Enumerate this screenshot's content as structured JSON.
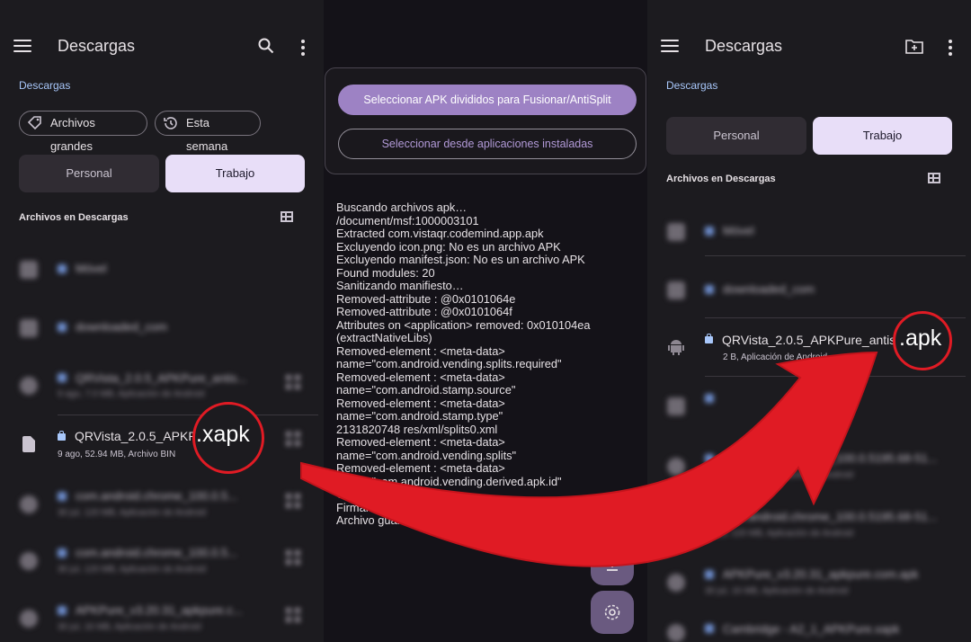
{
  "left": {
    "title": "Descargas",
    "breadcrumb": "Descargas",
    "chips": [
      "Archivos grandes",
      "Esta semana"
    ],
    "tabs": [
      "Personal",
      "Trabajo"
    ],
    "section": "Archivos en Descargas",
    "rows": [
      {
        "name": "Móvel"
      },
      {
        "name": "downloaded_com"
      },
      {
        "name": "QRVista_2.0.5_APKPure_antis...",
        "sub": "9 ago, 7.0 MB, Aplicación de Android"
      },
      {
        "name": "QRVista_2.0.5_APKP",
        "sub": "9 ago, 52.94 MB, Archivo BIN",
        "ext": ".xapk",
        "highlight": true
      },
      {
        "name": "com.android.chrome_100.0.5...",
        "sub": "30 jul, 120 MB, Aplicación de Android"
      },
      {
        "name": "com.android.chrome_100.0.5...",
        "sub": "30 jul, 120 MB, Aplicación de Android"
      },
      {
        "name": "APKPure_v3.20.31_apkpure.c...",
        "sub": "30 jul, 16 MB, Aplicación de Android"
      }
    ]
  },
  "mid": {
    "primary_button": "Seleccionar APK divididos para Fusionar/AntiSplit",
    "secondary_button": "Seleccionar desde aplicaciones instaladas",
    "log": [
      "Buscando archivos apk…",
      "/document/msf:1000003101",
      "Extracted com.vistaqr.codemind.app.apk",
      "Excluyendo icon.png: No es un archivo APK",
      "Excluyendo manifest.json: No es un archivo APK",
      "Found modules: 20",
      "Sanitizando manifiesto…",
      "Removed-attribute : @0x0101064e",
      "Removed-attribute : @0x0101064f",
      "Attributes on <application> removed: 0x010104ea",
      "(extractNativeLibs)",
      "Removed-element : <meta-data>",
      "name=\"com.android.vending.splits.required\"",
      "Removed-element : <meta-data>",
      "name=\"com.android.stamp.source\"",
      "Removed-element : <meta-data>",
      "name=\"com.android.stamp.type\"",
      "2131820748 res/xml/splits0.xml",
      "Removed-element : <meta-data>",
      "name=\"com.android.vending.splits\"",
      "Removed-element : <meta-data>",
      "name=\"com.android.vending.derived.apk.id\"",
      "Gu",
      "Firmando",
      "Archivo guardado exito"
    ]
  },
  "right": {
    "title": "Descargas",
    "breadcrumb": "Descargas",
    "tabs": [
      "Personal",
      "Trabajo"
    ],
    "section": "Archivos en Descargas",
    "rows": [
      {
        "name": "Móvel"
      },
      {
        "name": "downloaded_com"
      },
      {
        "name": "QRVista_2.0.5_APKPure_antis",
        "sub": "2 B, Aplicación de Android",
        "ext": ".apk",
        "highlight": true
      },
      {
        "name": "",
        "sub": ""
      },
      {
        "name": "com.android.chrome_100.0.5195.68-51...",
        "sub": "30 jul, 120 MB, Aplicación de Android"
      },
      {
        "name": "com.android.chrome_100.0.5195.68-51...",
        "sub": "30 jul, 120 MB, Aplicación de Android"
      },
      {
        "name": "APKPure_v3.20.31_apkpure.com.apk",
        "sub": "30 jul, 16 MB, Aplicación de Android"
      },
      {
        "name": "Cambridge - A2_1_APKPure.xapk",
        "sub": ""
      }
    ]
  },
  "colors": {
    "accent": "#9d82c4",
    "highlight": "#e01b24",
    "link": "#a8c7fa"
  }
}
